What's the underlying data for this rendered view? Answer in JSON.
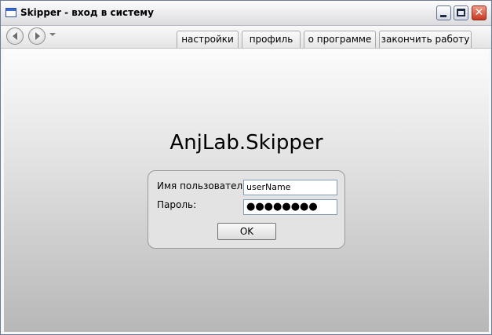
{
  "window": {
    "title": "Skipper - вход в систему"
  },
  "tabs": [
    {
      "label": "настройки"
    },
    {
      "label": "профиль"
    },
    {
      "label": "о программе"
    },
    {
      "label": "закончить работу"
    }
  ],
  "main": {
    "app_title": "AnjLab.Skipper"
  },
  "login": {
    "username_label": "Имя пользователя:",
    "username_value": "userName",
    "password_label": "Пароль:",
    "password_masked": "●●●●●●●●",
    "ok_label": "OK"
  },
  "icons": {
    "back": "arrow-left-icon",
    "forward": "arrow-right-icon",
    "history_dropdown": "chevron-down-icon",
    "minimize": "minimize-icon",
    "maximize": "maximize-icon",
    "close": "close-icon"
  },
  "colors": {
    "close_button": "#c9371f",
    "input_border": "#7f9db9"
  }
}
